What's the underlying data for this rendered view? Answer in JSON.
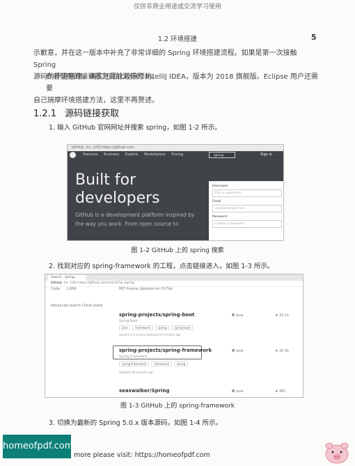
{
  "watermark": "仅供非商业用途或交流学习使用",
  "running_head": "1.2  环境搭建",
  "page_number": "5",
  "intro_line1": "示歉意，并在这一版本中补充了非常详细的 Spring 环境搭建流程。如果是第一次接触 Spring",
  "intro_line2": "源码的环境搭建，确实还是比较麻烦的。",
  "editor_line1": "作者使用的编译器为目前流行的 IntelliJ IDEA，版本为 2018 旗舰版。Eclipse 用户还需要",
  "editor_line2": "自己揣摩环境搭建方法，这里不再赘述。",
  "section": {
    "number": "1.2.1",
    "title": "源码链接获取"
  },
  "step1": "1.  输入 GitHub 官网网址并搜索 spring，如图 1-2 所示。",
  "figure_1_2": {
    "url": "GitHub, Inc. [US]   https://github.com",
    "nav": [
      "Features",
      "Business",
      "Explore",
      "Marketplace",
      "Pricing"
    ],
    "search_value": "spring",
    "signin": "Sign in",
    "hero_line1": "Built for",
    "hero_line2": "developers",
    "sub_line1": "GitHub is a development platform inspired by",
    "sub_line2": "the way you work. From open source to",
    "form": {
      "username_label": "Username",
      "username_placeholder": "Pick a username",
      "email_label": "Email",
      "email_placeholder": "you@example.com",
      "password_label": "Password",
      "password_placeholder": "Create a password"
    },
    "caption": "图 1-2    GitHub 上的 spring 搜索"
  },
  "step2": "2.  找到对应的 spring-framework 的工程，点击链接进入，如图 1-3 所示。",
  "figure_1_3": {
    "tab_title": "Search · spring · GitHub",
    "url": "GitHub, Inc. [US]   https://github.com/search?q=spring",
    "repos_label": "Code",
    "repos_count": "1,664",
    "sort_text": "MIT license    Updated on 19 Feb",
    "filters": "Advanced search    Cheat sheet",
    "results": [
      {
        "name": "spring-projects/spring-boot",
        "description": "Spring Boot",
        "tags": [
          "java",
          "framework",
          "spring",
          "spring-boot"
        ],
        "meta": "Apache-2.0 license    Updated 16 minutes ago",
        "language": "Java",
        "stars": "★ 33.1k"
      },
      {
        "name": "spring-projects/spring-framework",
        "description": "Spring Framework",
        "tags": [
          "spring-framework",
          "framework",
          "spring"
        ],
        "meta": "Updated 44 minutes ago",
        "language": "Java",
        "stars": "★ 20.3k"
      },
      {
        "name": "seaswalker/Spring",
        "description": "",
        "tags": [],
        "meta": "",
        "language": "Java",
        "stars": "★ 482"
      }
    ],
    "caption": "图 1-3    GitHub 上的 spring-framework"
  },
  "step3": "3.  切换为最新的 Spring 5.0.x 版本源码，如图 1-4 所示。",
  "promo": {
    "box_text": "homeofpdf.com",
    "text": "more please visit: https://homeofpdf.com"
  }
}
